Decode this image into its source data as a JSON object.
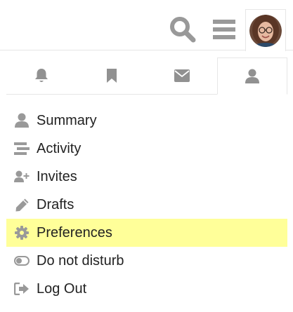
{
  "colors": {
    "icon_gray": "#999999",
    "icon_dark": "#919191",
    "highlight": "#ffff99",
    "border": "#e6e6e6",
    "text": "#222222"
  },
  "header": {
    "search_icon": "search-icon",
    "menu_icon": "hamburger-menu-icon",
    "user_avatar": "avatar"
  },
  "tabs": [
    {
      "icon": "bell-icon",
      "name": "notifications"
    },
    {
      "icon": "bookmark-icon",
      "name": "bookmarks"
    },
    {
      "icon": "envelope-icon",
      "name": "messages"
    },
    {
      "icon": "user-icon",
      "name": "profile",
      "active": true
    }
  ],
  "menu": {
    "items": [
      {
        "label": "Summary",
        "icon": "user-icon"
      },
      {
        "label": "Activity",
        "icon": "stream-icon"
      },
      {
        "label": "Invites",
        "icon": "user-plus-icon"
      },
      {
        "label": "Drafts",
        "icon": "pencil-icon"
      },
      {
        "label": "Preferences",
        "icon": "cog-icon",
        "highlighted": true
      },
      {
        "label": "Do not disturb",
        "icon": "toggle-off-icon"
      },
      {
        "label": "Log Out",
        "icon": "sign-out-icon"
      }
    ]
  }
}
